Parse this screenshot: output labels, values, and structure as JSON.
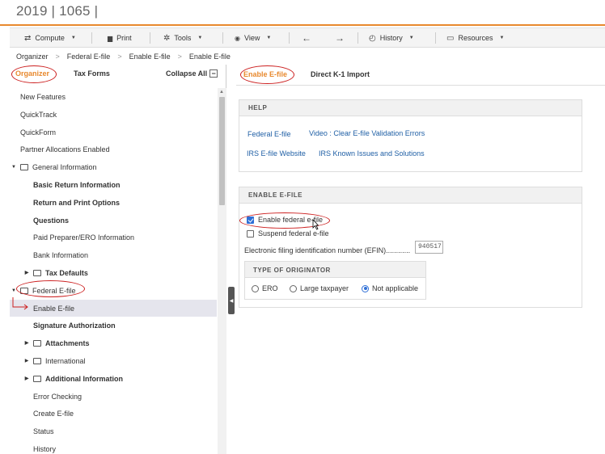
{
  "app": {
    "title": "2019 | 1065 |"
  },
  "toolbar": {
    "items": [
      {
        "label": "Compute",
        "icon": "compute-arrows-icon",
        "glyph": "⇄",
        "dropdown": true
      },
      {
        "label": "Print",
        "icon": "printer-icon",
        "glyph": "▆",
        "dropdown": false
      },
      {
        "label": "Tools",
        "icon": "gear-icon",
        "glyph": "✲",
        "dropdown": true
      },
      {
        "label": "View",
        "icon": "eye-icon",
        "glyph": "◉",
        "dropdown": true
      },
      {
        "label": "",
        "icon": "back-arrow-icon",
        "glyph": "←",
        "dropdown": false
      },
      {
        "label": "",
        "icon": "forward-arrow-icon",
        "glyph": "→",
        "dropdown": false
      },
      {
        "label": "History",
        "icon": "history-clock-icon",
        "glyph": "◴",
        "dropdown": true
      },
      {
        "label": "Resources",
        "icon": "briefcase-icon",
        "glyph": "▭",
        "dropdown": true
      }
    ]
  },
  "breadcrumb": [
    "Organizer",
    "Federal E-file",
    "Enable E-file",
    "Enable E-file"
  ],
  "left_panel": {
    "tabs": {
      "organizer": "Organizer",
      "tax_forms": "Tax Forms",
      "collapse_all": "Collapse All",
      "collapse_glyph": "−"
    },
    "tree": [
      {
        "label": "New Features",
        "level": 0,
        "bold": false,
        "folder": false,
        "expand": ""
      },
      {
        "label": "QuickTrack",
        "level": 0,
        "bold": false,
        "folder": false,
        "expand": ""
      },
      {
        "label": "QuickForm",
        "level": 0,
        "bold": false,
        "folder": false,
        "expand": ""
      },
      {
        "label": "Partner Allocations Enabled",
        "level": 0,
        "bold": false,
        "folder": false,
        "expand": ""
      },
      {
        "label": "General Information",
        "level": 0,
        "bold": false,
        "folder": true,
        "expand": "▼"
      },
      {
        "label": "Basic Return Information",
        "level": 1,
        "bold": true,
        "folder": false,
        "expand": ""
      },
      {
        "label": "Return and Print Options",
        "level": 1,
        "bold": true,
        "folder": false,
        "expand": ""
      },
      {
        "label": "Questions",
        "level": 1,
        "bold": true,
        "folder": false,
        "expand": ""
      },
      {
        "label": "Paid Preparer/ERO Information",
        "level": 1,
        "bold": false,
        "folder": false,
        "expand": ""
      },
      {
        "label": "Bank Information",
        "level": 1,
        "bold": false,
        "folder": false,
        "expand": ""
      },
      {
        "label": "Tax Defaults",
        "level": 1,
        "bold": true,
        "folder": true,
        "expand": "▶"
      },
      {
        "label": "Federal E-file",
        "level": 0,
        "bold": false,
        "folder": true,
        "expand": "▼"
      },
      {
        "label": "Enable E-file",
        "level": 1,
        "bold": false,
        "folder": false,
        "expand": "",
        "selected": true
      },
      {
        "label": "Signature Authorization",
        "level": 1,
        "bold": true,
        "folder": false,
        "expand": ""
      },
      {
        "label": "Attachments",
        "level": 1,
        "bold": true,
        "folder": true,
        "expand": "▶"
      },
      {
        "label": "International",
        "level": 1,
        "bold": false,
        "folder": true,
        "expand": "▶"
      },
      {
        "label": "Additional Information",
        "level": 1,
        "bold": true,
        "folder": true,
        "expand": "▶"
      },
      {
        "label": "Error Checking",
        "level": 1,
        "bold": false,
        "folder": false,
        "expand": ""
      },
      {
        "label": "Create E-file",
        "level": 1,
        "bold": false,
        "folder": false,
        "expand": ""
      },
      {
        "label": "Status",
        "level": 1,
        "bold": false,
        "folder": false,
        "expand": ""
      },
      {
        "label": "History",
        "level": 1,
        "bold": false,
        "folder": false,
        "expand": ""
      }
    ]
  },
  "right_panel": {
    "tabs": {
      "enable_efile": "Enable E-file",
      "k1_import": "Direct K-1 Import"
    },
    "help": {
      "heading": "HELP",
      "links": [
        "Federal E-file",
        "Video : Clear E-file Validation Errors",
        "IRS E-file Website",
        "IRS Known Issues and Solutions"
      ]
    },
    "enable": {
      "heading": "ENABLE E-FILE",
      "enable_federal": {
        "label": "Enable federal e-file",
        "checked": true
      },
      "suspend_federal": {
        "label": "Suspend federal e-file",
        "checked": false
      },
      "efin_label": "Electronic filing identification number (EFIN)............",
      "efin_value": "940517",
      "originator": {
        "heading": "TYPE OF ORIGINATOR",
        "options": [
          {
            "label": "ERO",
            "selected": false
          },
          {
            "label": "Large taxpayer",
            "selected": false
          },
          {
            "label": "Not applicable",
            "selected": true
          }
        ]
      }
    }
  },
  "colors": {
    "accent": "#e8892e",
    "link": "#1f5fa5",
    "annotation": "#cc1f1f",
    "check": "#2f6fd6"
  }
}
